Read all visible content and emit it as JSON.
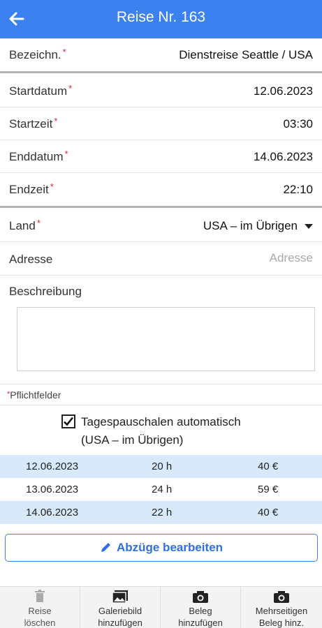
{
  "header": {
    "title": "Reise Nr. 163"
  },
  "form": {
    "bezeichn": {
      "label": "Bezeichn.",
      "value": "Dienstreise Seattle / USA"
    },
    "startdatum": {
      "label": "Startdatum",
      "value": "12.06.2023"
    },
    "startzeit": {
      "label": "Startzeit",
      "value": "03:30"
    },
    "enddatum": {
      "label": "Enddatum",
      "value": "14.06.2023"
    },
    "endzeit": {
      "label": "Endzeit",
      "value": "22:10"
    },
    "land": {
      "label": "Land",
      "value": "USA – im Übrigen"
    },
    "adresse": {
      "label": "Adresse",
      "placeholder": "Adresse"
    },
    "beschreibung": {
      "label": "Beschreibung"
    },
    "required_marker": "*",
    "required_note": "Pflichtfelder"
  },
  "allowance": {
    "checked": true,
    "line1": "Tagespauschalen automatisch",
    "line2": "(USA – im Übrigen)",
    "rows": [
      {
        "date": "12.06.2023",
        "hours": "20 h",
        "amount": "40 €"
      },
      {
        "date": "13.06.2023",
        "hours": "24 h",
        "amount": "59 €"
      },
      {
        "date": "14.06.2023",
        "hours": "22 h",
        "amount": "40 €"
      }
    ]
  },
  "edit_button": {
    "label": "Abzüge bearbeiten"
  },
  "bottom_bar": {
    "tabs": [
      {
        "line1": "Reise",
        "line2": "löschen",
        "icon": "trash-icon"
      },
      {
        "line1": "Galeriebild",
        "line2": "hinzufügen",
        "icon": "gallery-icon"
      },
      {
        "line1": "Beleg",
        "line2": "hinzufügen",
        "icon": "camera-icon"
      },
      {
        "line1": "Mehrseitigen",
        "line2": "Beleg hinz.",
        "icon": "camera-icon"
      }
    ]
  },
  "colors": {
    "header": "#3b82f0",
    "required": "#d6263b",
    "highlight_row": "#d7e9fb"
  }
}
